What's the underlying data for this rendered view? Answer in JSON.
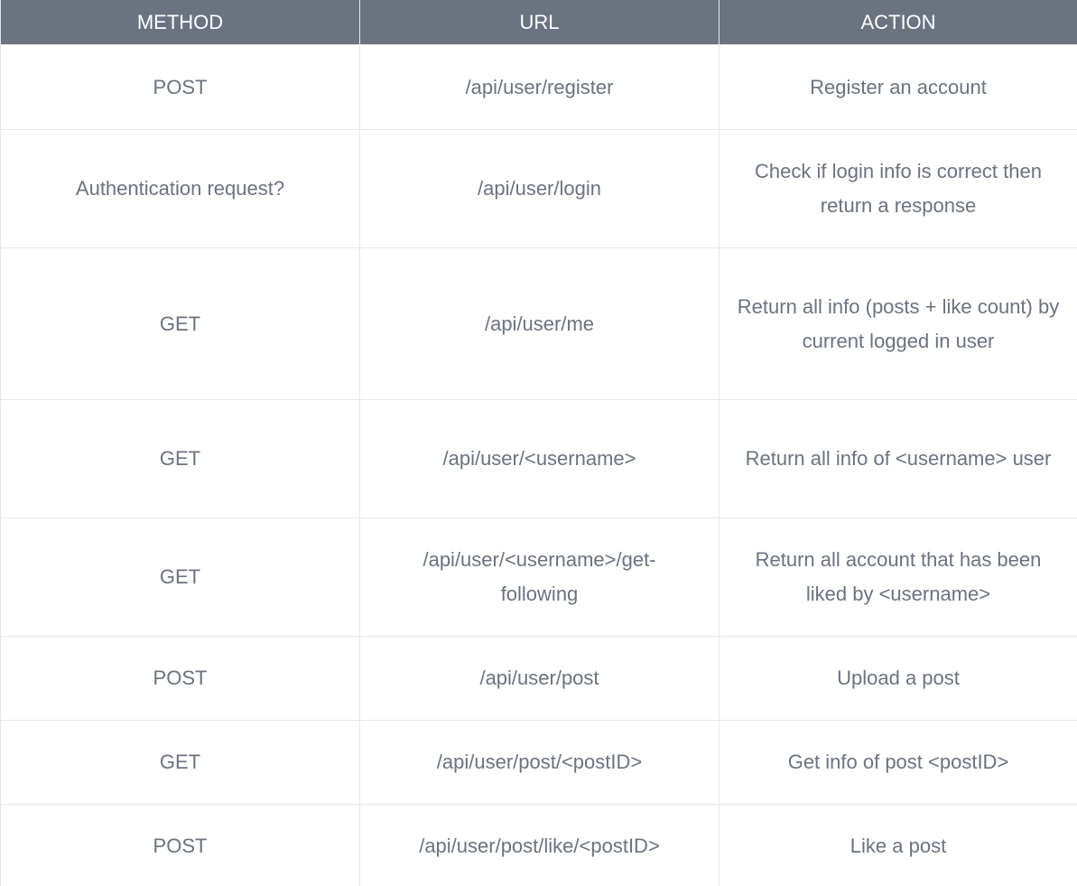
{
  "table": {
    "headers": {
      "method": "METHOD",
      "url": "URL",
      "action": "ACTION"
    },
    "rows": [
      {
        "method": "POST",
        "url": "/api/user/register",
        "action": "Register an account"
      },
      {
        "method": "Authentication request?",
        "url": "/api/user/login",
        "action": "Check if login info is correct then return a response"
      },
      {
        "method": "GET",
        "url": "/api/user/me",
        "action": "Return all info (posts + like count) by current logged in user"
      },
      {
        "method": "GET",
        "url": "/api/user/<username>",
        "action": "Return all info of <username> user"
      },
      {
        "method": "GET",
        "url": "/api/user/<username>/get-following",
        "action": "Return all account that has been liked by <username>"
      },
      {
        "method": "POST",
        "url": "/api/user/post",
        "action": "Upload a post"
      },
      {
        "method": "GET",
        "url": "/api/user/post/<postID>",
        "action": "Get info of post <postID>"
      },
      {
        "method": "POST",
        "url": "/api/user/post/like/<postID>",
        "action": "Like a post"
      }
    ]
  },
  "colors": {
    "header_bg": "#6b7280",
    "header_text": "#ffffff",
    "cell_text": "#6b7280",
    "border": "#e5e7eb"
  }
}
